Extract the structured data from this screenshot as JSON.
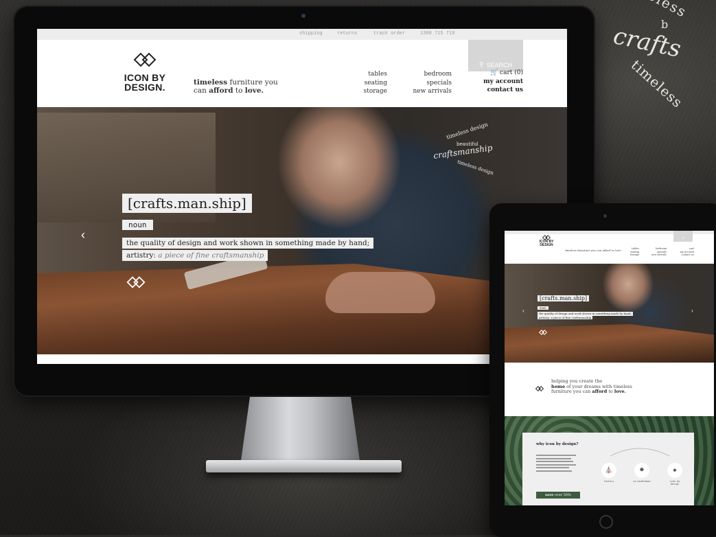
{
  "stamp": {
    "line1": "timeless",
    "line2": "b",
    "line3": "crafts",
    "line4": "timeless"
  },
  "desktop": {
    "topbar": {
      "shipping": "shipping",
      "returns": "returns",
      "track": "track order",
      "phone": "1300 715 719"
    },
    "search_label": "SEARCH",
    "logo": {
      "line1": "ICON BY",
      "line2": "DESIGN."
    },
    "tagline": {
      "w1": "timeless",
      "w2": " furniture you",
      "w3": "can ",
      "w4": "afford",
      "w5": " to ",
      "w6": "love."
    },
    "nav_col1": [
      "tables",
      "seating",
      "storage"
    ],
    "nav_col2": [
      "bedroom",
      "specials",
      "new arrivals"
    ],
    "account": {
      "cart": "cart",
      "cart_count": "(0)",
      "my_account": "my account",
      "contact": "contact us"
    },
    "hero": {
      "title": "[crafts.man.ship]",
      "pos": "noun",
      "def_line1": "the quality of design and work shown in something made by hand;",
      "def_line2_a": "artistry: ",
      "def_line2_b": "a piece of fine craftsmanship",
      "stamp": {
        "a": "timeless design",
        "b": "beautiful",
        "c": "craftsmanship",
        "d": "timeless design"
      }
    }
  },
  "tablet": {
    "logo": {
      "line1": "ICON BY",
      "line2": "DESIGN"
    },
    "tagline": "timeless furniture you can afford to love.",
    "hero": {
      "title": "[crafts.man.ship]",
      "pos": "noun",
      "def_line1": "the quality of design and work shown in something made by hand;",
      "def_line2": "artistry: a piece of fine craftsmanship"
    },
    "mid": {
      "l1": "helping you create the",
      "l2a": "home",
      "l2b": " of your dreams with timeless",
      "l3a": "furniture you can ",
      "l3b": "afford",
      "l3c": " to ",
      "l3d": "love."
    },
    "why": {
      "heading": "why icon by design?",
      "save_a": "save",
      "save_b": " over 50%",
      "icons": [
        {
          "label": "factory"
        },
        {
          "label": "no middleman"
        },
        {
          "label": "icon by design"
        }
      ]
    }
  }
}
